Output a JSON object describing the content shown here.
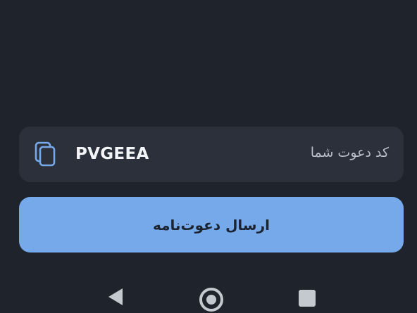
{
  "colors": {
    "background": "#1f232b",
    "card": "#2b303a",
    "accent": "#76a9ea",
    "code_text": "#f3f5f8",
    "label_text": "#b9bec8"
  },
  "invite_card": {
    "label": "کد دعوت شما",
    "code": "PVGEEA",
    "copy_icon": "copy-icon"
  },
  "send_button": {
    "label": "ارسال دعوت‌نامه"
  },
  "nav_bar": {
    "icons": [
      "back-triangle-icon",
      "home-circle-icon",
      "recents-square-icon"
    ]
  }
}
